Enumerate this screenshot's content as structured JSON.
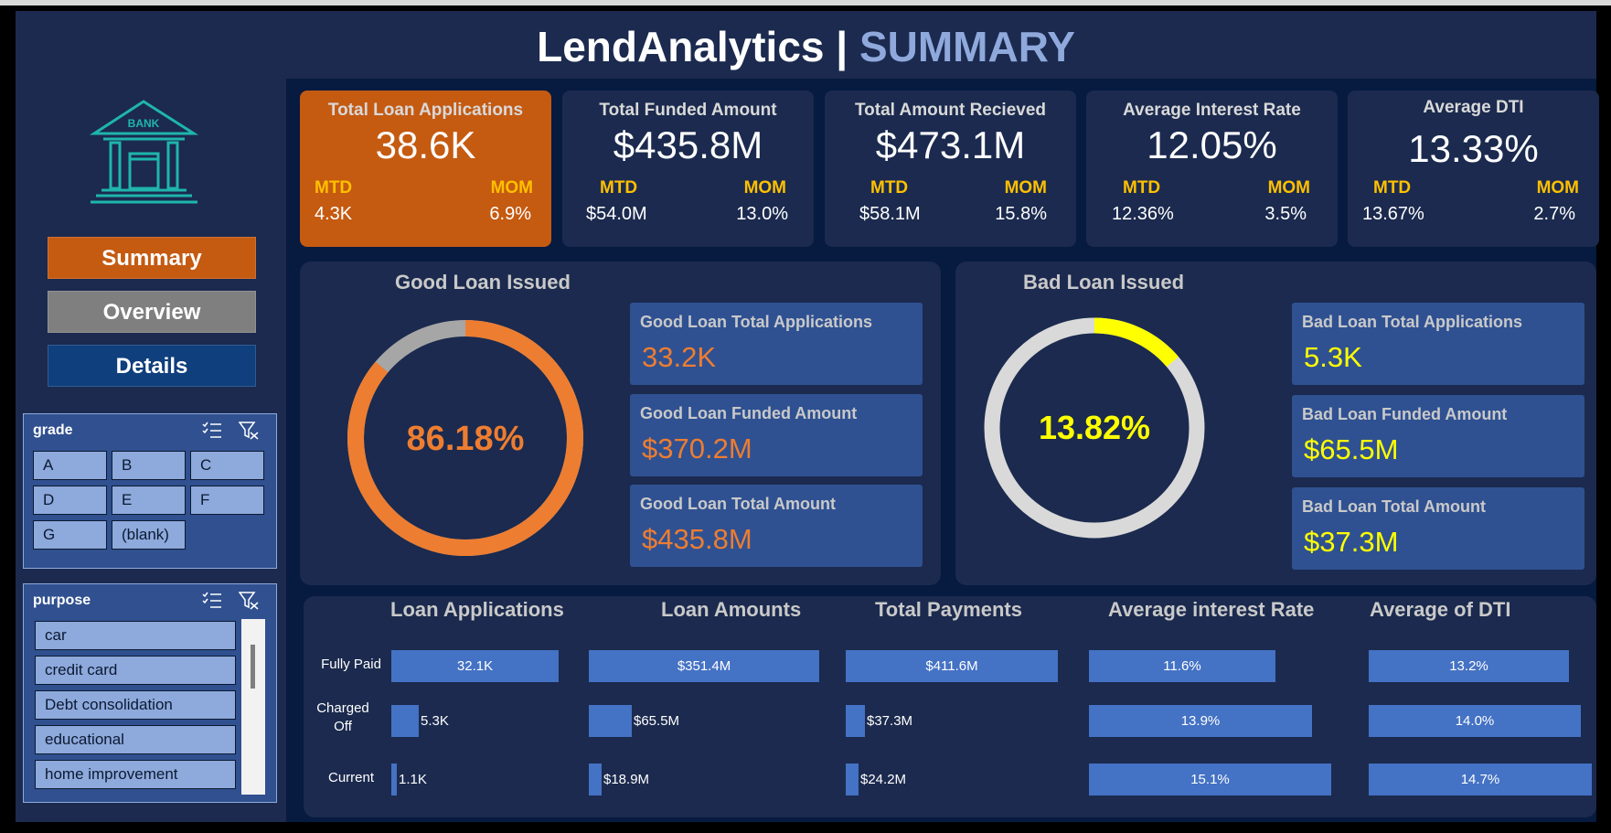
{
  "title": {
    "main": "LendAnalytics |",
    "sub": "SUMMARY"
  },
  "colors": {
    "accent_orange": "#c55a11",
    "good_ring": "#ed7d31",
    "bad_ring": "#ffff00",
    "kpi_label": "#ffc000",
    "bar": "#4472c4"
  },
  "sidebar": {
    "logo_icon": "bank-icon",
    "logo_text": "BANK",
    "nav": {
      "summary": "Summary",
      "overview": "Overview",
      "details": "Details"
    },
    "grade_slicer": {
      "title": "grade",
      "items": [
        "A",
        "B",
        "C",
        "D",
        "E",
        "F",
        "G",
        "(blank)"
      ]
    },
    "purpose_slicer": {
      "title": "purpose",
      "items": [
        "car",
        "credit card",
        "Debt consolidation",
        "educational",
        "home improvement"
      ]
    }
  },
  "kpis": [
    {
      "title": "Total Loan Applications",
      "value": "38.6K",
      "mtd_label": "MTD",
      "mom_label": "MOM",
      "mtd": "4.3K",
      "mom": "6.9%"
    },
    {
      "title": "Total Funded Amount",
      "value": "$435.8M",
      "mtd_label": "MTD",
      "mom_label": "MOM",
      "mtd": "$54.0M",
      "mom": "13.0%"
    },
    {
      "title": "Total Amount Recieved",
      "value": "$473.1M",
      "mtd_label": "MTD",
      "mom_label": "MOM",
      "mtd": "$58.1M",
      "mom": "15.8%"
    },
    {
      "title": "Average Interest Rate",
      "value": "12.05%",
      "mtd_label": "MTD",
      "mom_label": "MOM",
      "mtd": "12.36%",
      "mom": "3.5%"
    },
    {
      "title": "Average DTI",
      "value": "13.33%",
      "mtd_label": "MTD",
      "mom_label": "MOM",
      "mtd": "13.67%",
      "mom": "2.7%"
    }
  ],
  "good_loan": {
    "title": "Good Loan Issued",
    "percent_label": "86.18%",
    "percent": 86.18,
    "cards": [
      {
        "label": "Good Loan Total Applications",
        "value": "33.2K"
      },
      {
        "label": "Good Loan Funded Amount",
        "value": "$370.2M"
      },
      {
        "label": "Good Loan Total Amount",
        "value": "$435.8M"
      }
    ]
  },
  "bad_loan": {
    "title": "Bad Loan Issued",
    "percent_label": "13.82%",
    "percent": 13.82,
    "cards": [
      {
        "label": "Bad Loan Total Applications",
        "value": "5.3K"
      },
      {
        "label": "Bad Loan Funded Amount",
        "value": "$65.5M"
      },
      {
        "label": "Bad Loan Total Amount",
        "value": "$37.3M"
      }
    ]
  },
  "chart_data": {
    "type": "bar",
    "orientation": "horizontal",
    "categories": [
      "Fully Paid",
      "Charged Off",
      "Current"
    ],
    "series": [
      {
        "name": "Loan Applications",
        "values": [
          32.1,
          5.3,
          1.1
        ],
        "unit": "K",
        "labels": [
          "32.1K",
          "5.3K",
          "1.1K"
        ]
      },
      {
        "name": "Loan Amounts",
        "values": [
          351.4,
          65.5,
          18.9
        ],
        "unit": "$M",
        "labels": [
          "$351.4M",
          "$65.5M",
          "$18.9M"
        ]
      },
      {
        "name": "Total Payments",
        "values": [
          411.6,
          37.3,
          24.2
        ],
        "unit": "$M",
        "labels": [
          "$411.6M",
          "$37.3M",
          "$24.2M"
        ]
      },
      {
        "name": "Average interest Rate",
        "values": [
          11.6,
          13.9,
          15.1
        ],
        "unit": "%",
        "labels": [
          "11.6%",
          "13.9%",
          "15.1%"
        ]
      },
      {
        "name": "Average of DTI",
        "values": [
          13.2,
          14.0,
          14.7
        ],
        "unit": "%",
        "labels": [
          "13.2%",
          "14.0%",
          "14.7%"
        ]
      }
    ]
  }
}
